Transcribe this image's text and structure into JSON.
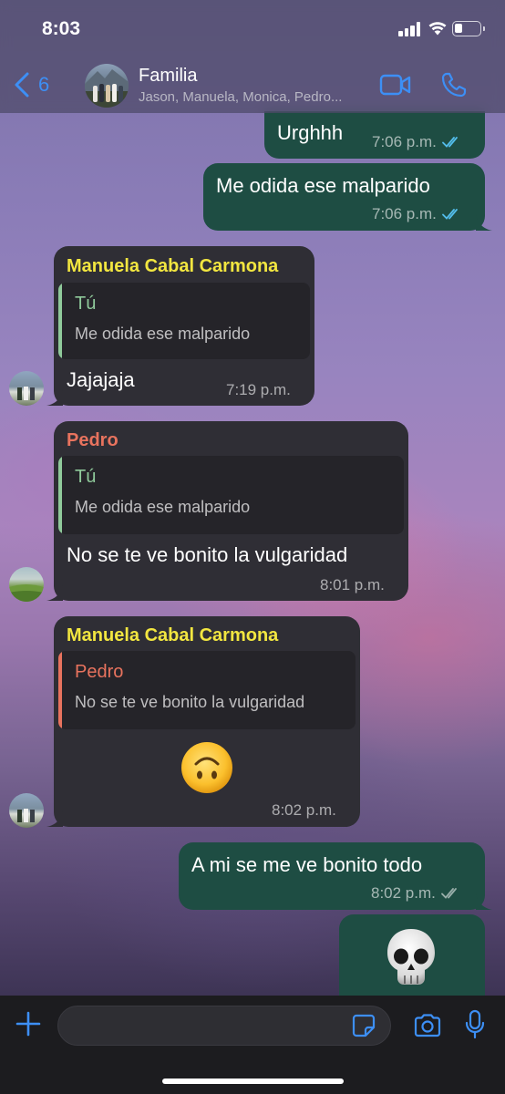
{
  "status_bar": {
    "time": "8:03"
  },
  "header": {
    "back_count": "6",
    "group_name": "Familia",
    "members": "Jason, Manuela, Monica, Pedro..."
  },
  "messages": [
    {
      "type": "outgoing",
      "text": "Urghhh",
      "time": "7:06 p.m.",
      "status": "read"
    },
    {
      "type": "outgoing",
      "text": "Me odida ese malparido",
      "time": "7:06 p.m.",
      "status": "read"
    },
    {
      "type": "incoming",
      "sender": "Manuela Cabal Carmona",
      "quote": {
        "author": "Tú",
        "text": "Me odida ese malparido"
      },
      "text": "Jajajaja",
      "time": "7:19 p.m."
    },
    {
      "type": "incoming",
      "sender": "Pedro",
      "quote": {
        "author": "Tú",
        "text": "Me odida ese malparido"
      },
      "text": "No se te ve bonito la vulgaridad",
      "time": "8:01 p.m."
    },
    {
      "type": "incoming",
      "sender": "Manuela Cabal Carmona",
      "quote": {
        "author": "Pedro",
        "text": "No se te ve bonito la vulgaridad"
      },
      "text": "🙃",
      "time": "8:02 p.m."
    },
    {
      "type": "outgoing",
      "text": "A mi se me ve bonito todo",
      "time": "8:02 p.m.",
      "status": "delivered"
    },
    {
      "type": "outgoing",
      "text": "💀",
      "time": "",
      "status": ""
    }
  ],
  "colors": {
    "outgoing_bubble": "#1e4d43",
    "incoming_bubble": "#2f2e35",
    "accent_blue": "#3d8ff5",
    "read_ticks": "#53bdeb",
    "sender_manuela": "#f2e640",
    "sender_pedro": "#e8735e",
    "quote_tu": "#8fc99a",
    "quote_pedro": "#e8735e"
  },
  "input": {
    "placeholder": ""
  }
}
